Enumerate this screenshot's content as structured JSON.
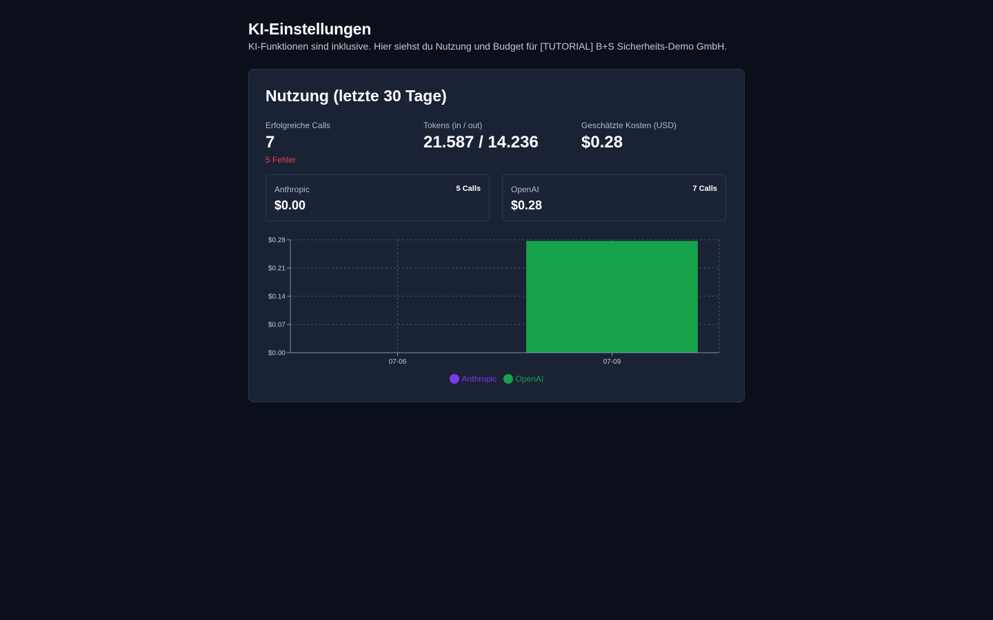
{
  "header": {
    "title": "KI-Einstellungen",
    "subtitle": "KI-Funktionen sind inklusive. Hier siehst du Nutzung und Budget für [TUTORIAL] B+S Sicherheits-Demo GmbH."
  },
  "usage": {
    "title": "Nutzung (letzte 30 Tage)",
    "stats": {
      "calls_label": "Erfolgreiche Calls",
      "calls_value": "7",
      "errors": "5 Fehler",
      "tokens_label": "Tokens (in / out)",
      "tokens_value": "21.587 / 14.236",
      "cost_label": "Geschätzte Kosten (USD)",
      "cost_value": "$0.28"
    },
    "providers": [
      {
        "name": "Anthropic",
        "calls": "5 Calls",
        "cost": "$0.00"
      },
      {
        "name": "OpenAI",
        "calls": "7 Calls",
        "cost": "$0.28"
      }
    ]
  },
  "colors": {
    "anthropic": "#7c3aed",
    "openai": "#16a34a",
    "error": "#ef4444"
  },
  "chart_data": {
    "type": "bar",
    "stacked": true,
    "categories": [
      "07-06",
      "07-09"
    ],
    "series": [
      {
        "name": "Anthropic",
        "values": [
          0.0,
          0.0
        ],
        "color": "#7c3aed"
      },
      {
        "name": "OpenAI",
        "values": [
          0.0,
          0.277
        ],
        "color": "#16a34a"
      }
    ],
    "y_ticks": [
      "$0.00",
      "$0.07",
      "$0.14",
      "$0.21",
      "$0.28"
    ],
    "y_tick_values": [
      0,
      0.07,
      0.14,
      0.21,
      0.28
    ],
    "ylim": [
      0,
      0.28
    ],
    "grid": true,
    "legend": "bottom-center",
    "xlabel": "",
    "ylabel": ""
  }
}
